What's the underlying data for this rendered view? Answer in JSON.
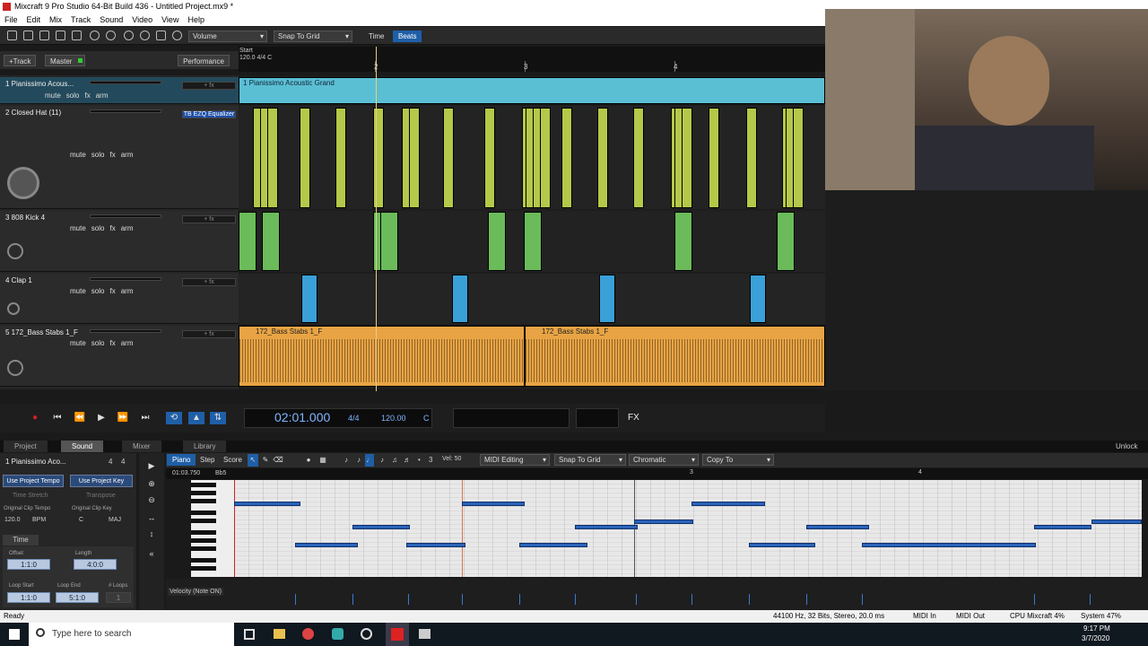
{
  "title": "Mixcraft 9 Pro Studio 64-Bit Build 436 - Untitled Project.mx9 *",
  "menu": [
    "File",
    "Edit",
    "Mix",
    "Track",
    "Sound",
    "Video",
    "View",
    "Help"
  ],
  "toolbar": {
    "volume": "Volume",
    "snap": "Snap To Grid",
    "time": "Time",
    "beats": "Beats"
  },
  "header": {
    "add_track": "+Track",
    "master": "Master",
    "performance": "Performance",
    "start_label": "Start",
    "start_value": "120.0 4/4 C"
  },
  "ruler_marks": [
    "2",
    "3",
    "4"
  ],
  "tracks": [
    {
      "name": "1 Pianissimo Acous...",
      "fx": "+ fx"
    },
    {
      "name": "2 Closed Hat (11)",
      "fx": "TB EZQ Equalizer"
    },
    {
      "name": "3 808 Kick 4",
      "fx": "+ fx"
    },
    {
      "name": "4 Clap 1",
      "fx": "+ fx"
    },
    {
      "name": "5 172_Bass Stabs 1_F",
      "fx": "+ fx"
    }
  ],
  "track_controls": {
    "mute": "mute",
    "solo": "solo",
    "fx": "fx",
    "arm": "arm"
  },
  "clips": {
    "piano": "1 Pianissimo Acoustic Grand",
    "bass1": "172_Bass Stabs 1_F",
    "bass2": "172_Bass Stabs 1_F"
  },
  "transport": {
    "time": "02:01.000",
    "sig": "4/4",
    "tempo": "120.00",
    "key": "C",
    "fx": "FX"
  },
  "bottom_tabs": [
    "Project",
    "Sound",
    "Mixer",
    "Library"
  ],
  "unlock": "Unlock",
  "clip_panel": {
    "name": "1 Pianissimo Aco...",
    "sig_a": "4",
    "sig_b": "4",
    "use_project_tempo": "Use Project Tempo",
    "use_project_key": "Use Project Key",
    "time_stretch": "Time Stretch",
    "transpose": "Transpose",
    "orig_tempo_lbl": "Original Clip Tempo",
    "orig_key_lbl": "Original Clip Key",
    "tempo_val": "120.0",
    "bpm": "BPM",
    "key_val": "C",
    "maj": "MAJ",
    "time_tab": "Time",
    "offset_lbl": "Offset",
    "offset_val": "1:1:0",
    "length_lbl": "Length",
    "length_val": "4:0:0",
    "loop_start_lbl": "Loop Start",
    "loop_start_val": "1:1:0",
    "loop_end_lbl": "Loop End",
    "loop_end_val": "5:1:0",
    "loops_lbl": "# Loops",
    "loops_val": "1"
  },
  "piano_toolbar": {
    "piano": "Piano",
    "step": "Step",
    "score": "Score",
    "vel": "Vel: 50",
    "midi_editing": "MIDI Editing",
    "snap": "Snap To Grid",
    "scale": "Chromatic",
    "copy": "Copy To",
    "grid_value": "3"
  },
  "piano_ruler": {
    "time": "01:03.750",
    "note": "Bb5",
    "marks": [
      "3",
      "4"
    ]
  },
  "velocity_label": "Velocity (Note ON)",
  "status": {
    "ready": "Ready",
    "audio": "44100 Hz, 32 Bits, Stereo, 20.0 ms",
    "midi_in": "MIDI In",
    "midi_out": "MIDI Out",
    "cpu": "CPU Mixcraft 4%",
    "system": "System 47%"
  },
  "taskbar": {
    "search": "Type here to search",
    "time": "9:17 PM",
    "date": "3/7/2020"
  },
  "colors": {
    "piano_clip": "#5bbfd4",
    "hat_clip": "#b5c84a",
    "kick_clip": "#6bbb5a",
    "clap_clip": "#3aa0d8",
    "bass_clip": "#e8a444",
    "accent": "#1f5fa8"
  }
}
